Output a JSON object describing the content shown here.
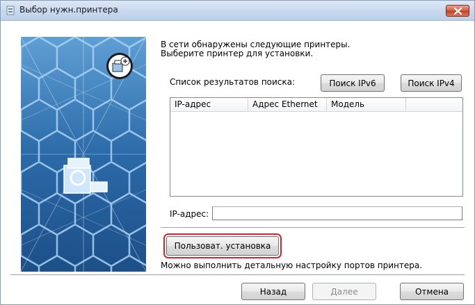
{
  "window": {
    "title": "Выбор нужн.принтера",
    "accent_color": "#d8232a"
  },
  "main": {
    "intro_line1": "В сети обнаружены следующие принтеры.",
    "intro_line2": "Выберите принтер для установки.",
    "search_results_label": "Список результатов поиска:",
    "search_ipv6_button": "Поиск IPv6",
    "search_ipv4_button": "Поиск IPv4",
    "list": {
      "columns": [
        "IP-адрес",
        "Адрес Ethernet",
        "Модель"
      ],
      "rows": []
    },
    "ip_label": "IP-адрес:",
    "ip_value": "",
    "custom_install_button": "Пользоват. установка",
    "custom_install_hint": "Можно выполнить детальную настройку портов принтера."
  },
  "footer": {
    "back_button": "Назад",
    "next_button": "Далее",
    "cancel_button": "Отмена"
  }
}
